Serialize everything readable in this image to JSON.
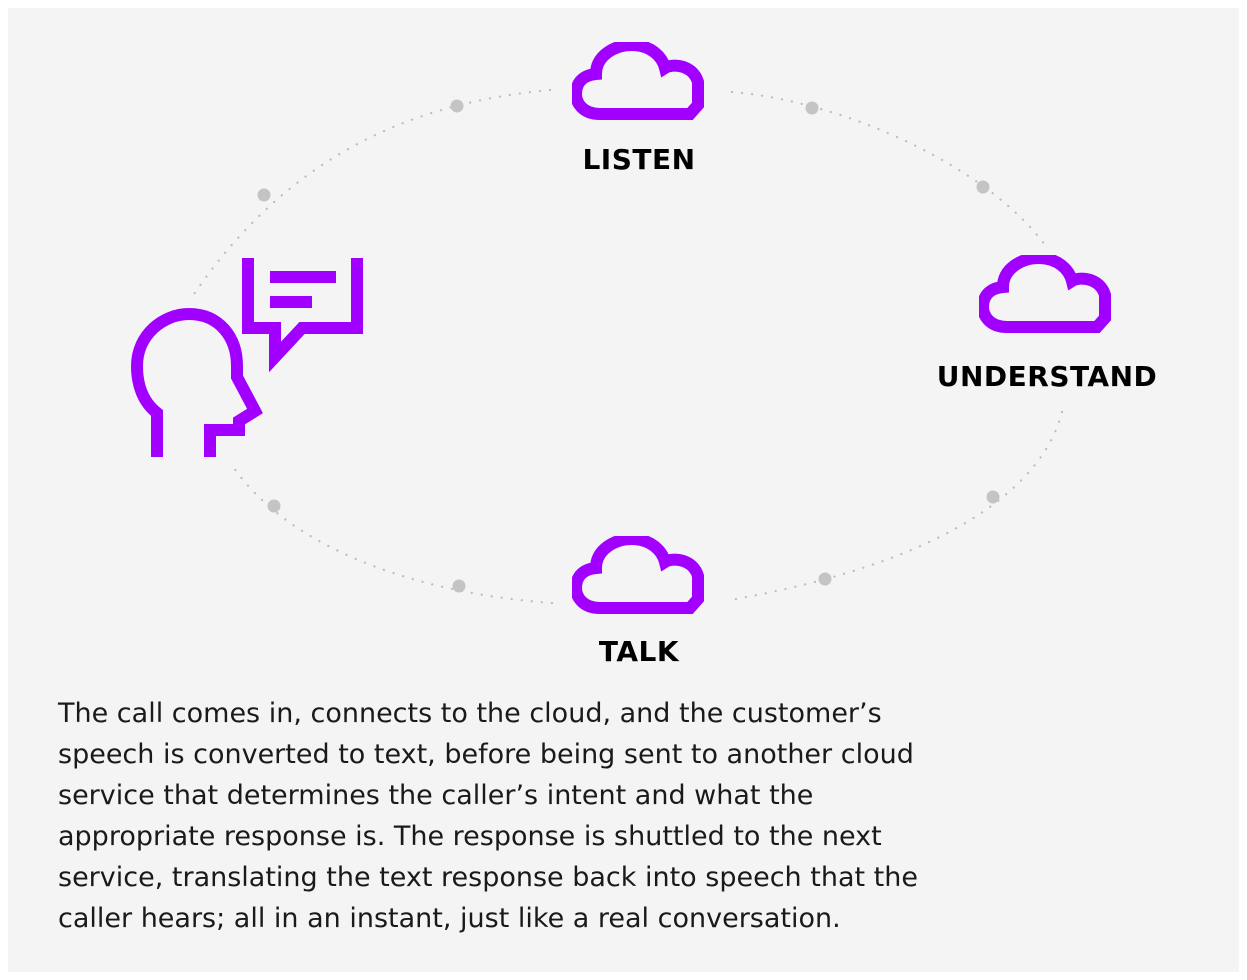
{
  "diagram": {
    "nodes": [
      {
        "id": "listen",
        "label": "LISTEN",
        "icon": "cloud-icon"
      },
      {
        "id": "understand",
        "label": "UNDERSTAND",
        "icon": "cloud-icon"
      },
      {
        "id": "talk",
        "label": "TALK",
        "icon": "cloud-icon"
      }
    ],
    "caller_icon": "person-speech-icon",
    "colors": {
      "accent": "#a100ff",
      "background": "#f4f4f4",
      "path": "#b8b8b8",
      "text": "#000000"
    }
  },
  "caption": "The call comes in, connects to the cloud, and the customer’s speech is converted to text, before being sent to another cloud service that determines the caller’s intent and what the appropriate response is. The response is shuttled to the next service, translating the text response back into speech that the caller hears; all in an instant, just like a real conversation."
}
